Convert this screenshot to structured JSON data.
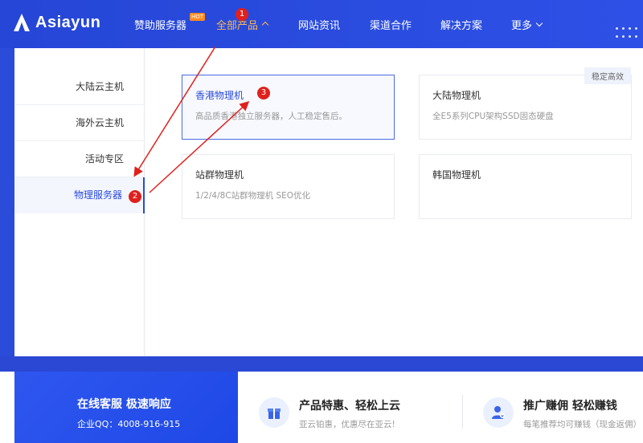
{
  "brand": {
    "name": "Asiayun"
  },
  "nav": {
    "items": [
      {
        "label": "赞助服务器"
      },
      {
        "label": "全部产品"
      },
      {
        "label": "网站资讯"
      },
      {
        "label": "渠道合作"
      },
      {
        "label": "解决方案"
      },
      {
        "label": "更多"
      }
    ],
    "hot_badge": "HOT"
  },
  "sidebar": {
    "items": [
      {
        "label": "大陆云主机"
      },
      {
        "label": "海外云主机"
      },
      {
        "label": "活动专区"
      },
      {
        "label": "物理服务器"
      }
    ]
  },
  "products": [
    {
      "title": "香港物理机",
      "desc": "高品质香港独立服务器，人工稳定售后。"
    },
    {
      "title": "大陆物理机",
      "desc": "全E5系列CPU架构SSD固态硬盘",
      "tag": "稳定高效"
    },
    {
      "title": "站群物理机",
      "desc": "1/2/4/8C站群物理机 SEO优化"
    },
    {
      "title": "韩国物理机",
      "desc": ""
    }
  ],
  "annotations": {
    "one": "1",
    "two": "2",
    "three": "3"
  },
  "footer": {
    "service_title": "在线客服 极速响应",
    "service_qq": "企业QQ：4008-916-915",
    "promo1_title": "产品特惠、轻松上云",
    "promo1_sub": "亚云铂惠，优惠尽在亚云!",
    "promo2_title": "推广赚佣 轻松赚钱",
    "promo2_sub": "每笔推荐均可赚钱（现金返佣）"
  },
  "colors": {
    "primary": "#2b4bd9",
    "active_nav": "#ffb84d",
    "annotation": "#e0201c"
  }
}
